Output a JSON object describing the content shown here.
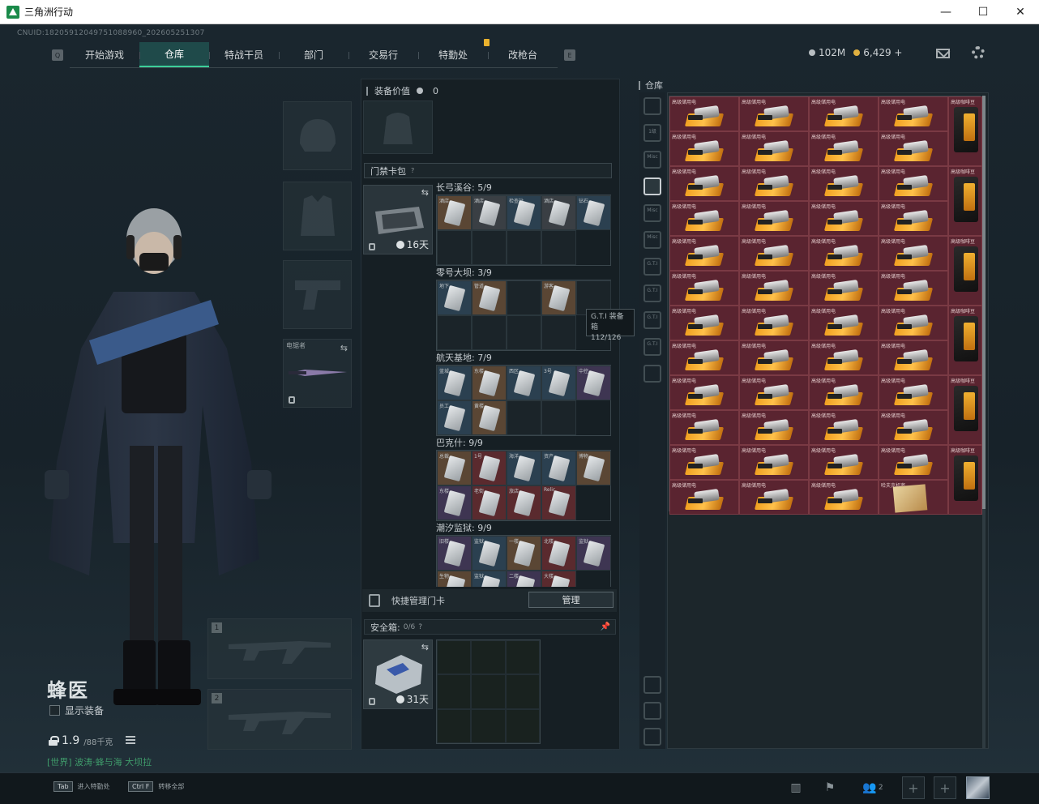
{
  "window": {
    "title": "三角洲行动",
    "minimize": "—",
    "maximize": "☐",
    "close": "✕"
  },
  "uid": "CNUID:18205912049751088960_202605251307",
  "nav": {
    "tabs": [
      "开始游戏",
      "仓库",
      "特战干员",
      "部门",
      "交易行",
      "特勤处",
      "改枪台"
    ],
    "active": "仓库",
    "left_key": "Q",
    "right_key": "E"
  },
  "currency": {
    "silver": "102M",
    "gold": "6,429 +",
    "silver_color": "#b8bec2",
    "gold_color": "#e0b040"
  },
  "operator": {
    "name": "蜂医",
    "show_gear": "显示装备",
    "weight": "1.9",
    "weight_max": "/88千克",
    "status": "[世界] 波涛·蜂与海 大坝拉"
  },
  "gear_slots": {
    "melee_label": "电锯者"
  },
  "weapon_slots": [
    "1",
    "2"
  ],
  "middle": {
    "gear_value_label": "装备价值",
    "gear_value": "0",
    "keybag_label": "门禁卡包",
    "keybag_timer": "16天",
    "maps": [
      {
        "title": "长弓溪谷: 5/9",
        "cards": [
          {
            "label": "酒店",
            "color": "tan"
          },
          {
            "label": "酒店",
            "color": "gray"
          },
          {
            "label": "检查站",
            "color": "blue"
          },
          {
            "label": "酒店",
            "color": "gray"
          },
          {
            "label": "钻石",
            "color": "blue"
          },
          {
            "label": "",
            "color": "empty"
          },
          {
            "label": "",
            "color": "empty"
          },
          {
            "label": "",
            "color": "empty"
          },
          {
            "label": "",
            "color": "empty"
          }
        ]
      },
      {
        "title": "零号大坝: 3/9",
        "cards": [
          {
            "label": "地下",
            "color": "blue"
          },
          {
            "label": "管道",
            "color": "tan"
          },
          {
            "label": "",
            "color": "empty"
          },
          {
            "label": "游客",
            "color": "tan"
          },
          {
            "label": "",
            "color": "empty"
          },
          {
            "label": "",
            "color": "empty"
          },
          {
            "label": "",
            "color": "empty"
          },
          {
            "label": "",
            "color": "empty"
          },
          {
            "label": "",
            "color": "empty"
          }
        ]
      },
      {
        "title": "航天基地: 7/9",
        "cards": [
          {
            "label": "蓝城",
            "color": "blue"
          },
          {
            "label": "东楼",
            "color": "tan"
          },
          {
            "label": "西区",
            "color": "blue"
          },
          {
            "label": "3号",
            "color": "blue"
          },
          {
            "label": "中控",
            "color": "purple"
          },
          {
            "label": "员工",
            "color": "blue"
          },
          {
            "label": "黄楼",
            "color": "tan"
          },
          {
            "label": "",
            "color": "empty"
          },
          {
            "label": "",
            "color": "empty"
          }
        ]
      },
      {
        "title": "巴克什: 9/9",
        "cards": [
          {
            "label": "总裁",
            "color": "tan"
          },
          {
            "label": "1号",
            "color": "red"
          },
          {
            "label": "海洋",
            "color": "blue"
          },
          {
            "label": "资产",
            "color": "blue"
          },
          {
            "label": "博物",
            "color": "tan"
          },
          {
            "label": "东楼",
            "color": "purple"
          },
          {
            "label": "老街",
            "color": "red"
          },
          {
            "label": "旅店",
            "color": "red"
          },
          {
            "label": "Relic",
            "color": "red"
          }
        ]
      },
      {
        "title": "潮汐监狱: 9/9",
        "cards": [
          {
            "label": "旧楼",
            "color": "purple"
          },
          {
            "label": "监狱",
            "color": "blue"
          },
          {
            "label": "一楼",
            "color": "tan"
          },
          {
            "label": "北楼",
            "color": "red"
          },
          {
            "label": "监狱",
            "color": "purple"
          },
          {
            "label": "生物",
            "color": "tan"
          },
          {
            "label": "监狱",
            "color": "blue"
          },
          {
            "label": "二楼",
            "color": "purple"
          },
          {
            "label": "大楼",
            "color": "red"
          }
        ]
      }
    ],
    "tooltip_title": "G.T.I 装备箱",
    "tooltip_value": "112/126",
    "quick_manage": "快捷管理门卡",
    "manage_button": "管理",
    "safebox_label": "安全箱:",
    "safebox_count": "0/6",
    "safebox_timer": "31天"
  },
  "stash": {
    "label": "仓库",
    "item_label": "高级储用电",
    "doc_label": "哈夫克机密",
    "bag_label": "高级咖啡豆",
    "sidebar": [
      "",
      "1级",
      "Misc",
      "",
      "Misc",
      "Misc",
      "G.T.I",
      "G.T.I",
      "G.T.I",
      "G.T.I",
      ""
    ]
  },
  "bottom": {
    "hint1_key": "Tab",
    "hint1": "进入特勤处",
    "hint2_key": "Ctrl F",
    "hint2": "转移全部",
    "friends": "2"
  }
}
